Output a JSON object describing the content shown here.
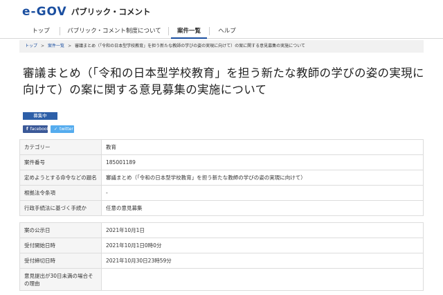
{
  "header": {
    "logo_text": "e-GOV",
    "logo_subtitle": "パブリック・コメント"
  },
  "nav": {
    "items": [
      {
        "label": "トップ"
      },
      {
        "label": "パブリック・コメント制度について"
      },
      {
        "label": "案件一覧",
        "active": true
      },
      {
        "label": "ヘルプ"
      }
    ]
  },
  "breadcrumb": {
    "items": [
      "トップ",
      "案件一覧",
      "審議まとめ（「令和の日本型学校教育」を担う新たな教師の学びの姿の実現に向けて）の案に関する意見募集の実施について"
    ]
  },
  "page": {
    "title": "審議まとめ（「令和の日本型学校教育」を担う新たな教師の学びの姿の実現に向けて）の案に関する意見募集の実施について",
    "status_badge": "募集中"
  },
  "social": {
    "facebook_label": "facebook",
    "twitter_label": "twitter",
    "facebook_icon": "facebook-icon",
    "twitter_icon": "twitter-icon"
  },
  "details_table_1": {
    "rows": [
      {
        "label": "カテゴリー",
        "value": "教育"
      },
      {
        "label": "案件番号",
        "value": "185001189"
      },
      {
        "label": "定めようとする命令などの題名",
        "value": "審議まとめ（「令和の日本型学校教育」を担う新たな教師の学びの姿の実現に向けて）"
      },
      {
        "label": "根拠法令条項",
        "value": "-"
      },
      {
        "label": "行政手続法に基づく手続か",
        "value": "任意の意見募集"
      }
    ]
  },
  "details_table_2": {
    "rows": [
      {
        "label": "案の公示日",
        "value": "2021年10月1日"
      },
      {
        "label": "受付開始日時",
        "value": "2021年10月1日0時0分"
      },
      {
        "label": "受付締切日時",
        "value": "2021年10月30日23時59分"
      },
      {
        "label": "意見提出が30日未満の場合その理由",
        "value": ""
      }
    ]
  },
  "colors": {
    "brand": "#1b4fa0",
    "badge": "#2d5fa8",
    "facebook": "#3b5998",
    "twitter": "#55acee"
  }
}
